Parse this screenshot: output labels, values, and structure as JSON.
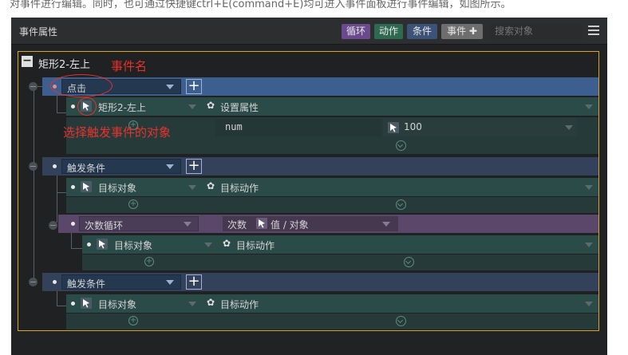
{
  "top_caption": "对事件进行编辑。同时，也可通过快捷键ctrl+E(command+E)均可进入事件面板进行事件编辑，如图所示。",
  "panel": {
    "title": "事件属性",
    "buttons": {
      "loop": "循环",
      "action": "动作",
      "condition": "条件",
      "event": "事件 ✚"
    },
    "search_placeholder": "搜索对象",
    "colors": {
      "accent_border": "#d9a326",
      "annotation_red": "#e8312b"
    }
  },
  "event": {
    "collapse_symbol": "−",
    "name": "矩形2-左上",
    "annotation_event_name": "事件名",
    "annotation_select_target": "选择触发事件的对象",
    "trigger": {
      "value": "点击",
      "plus": "+"
    },
    "target_object": "矩形2-左上",
    "action_label": "设置属性",
    "prop_name": "num",
    "prop_value": "100",
    "condition1": {
      "label": "触发条件",
      "plus": "+",
      "target": "目标对象",
      "action": "目标动作"
    },
    "loop": {
      "label": "次数循环",
      "count_label": "次数",
      "value_label": "值 / 对象",
      "target": "目标对象",
      "action": "目标动作"
    },
    "condition2": {
      "label": "触发条件",
      "plus": "+",
      "target": "目标对象",
      "action": "目标动作"
    }
  }
}
